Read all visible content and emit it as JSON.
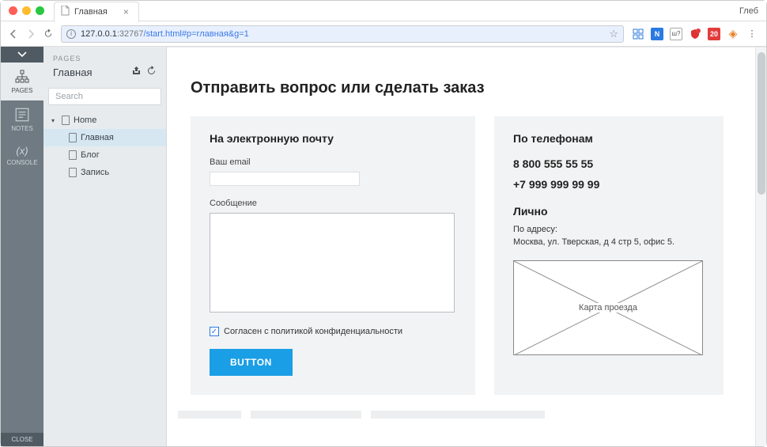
{
  "browser": {
    "tab_title": "Главная",
    "profile_name": "Глеб",
    "url_host": "127.0.0.1",
    "url_port": ":32767",
    "url_path": "/start.html#p=главная&g=1",
    "toolbar_badges": {
      "blue": "N",
      "shu": "ш?",
      "red_count": "20"
    }
  },
  "rail": {
    "pages": "PAGES",
    "notes": "NOTES",
    "console": "CONSOLE",
    "console_symbol": "(x)",
    "close": "CLOSE"
  },
  "sidebar": {
    "eyebrow": "PAGES",
    "title": "Главная",
    "search_placeholder": "Search",
    "tree": {
      "root": "Home",
      "items": [
        "Главная",
        "Блог",
        "Запись"
      ]
    }
  },
  "page": {
    "heading": "Отправить вопрос или сделать заказ",
    "form": {
      "section_title": "На электронную почту",
      "email_label": "Ваш email",
      "message_label": "Сообщение",
      "consent_label": "Согласен с политикой конфиденциальности",
      "button_label": "BUTTON"
    },
    "contact": {
      "phones_title": "По телефонам",
      "phone1": "8 800 555 55 55",
      "phone2": "+7 999 999 99 99",
      "in_person_title": "Лично",
      "address_label": "По адресу:",
      "address_value": "Москва, ул. Тверская, д 4 стр 5, офис 5.",
      "map_placeholder": "Карта проезда"
    }
  }
}
